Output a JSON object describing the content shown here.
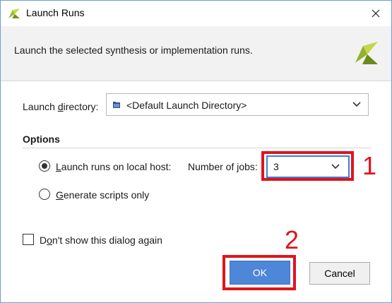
{
  "window": {
    "title": "Launch Runs"
  },
  "header": {
    "description": "Launch the selected synthesis or implementation runs."
  },
  "launch_directory": {
    "label_pre": "Launch ",
    "label_underline": "d",
    "label_post": "irectory:",
    "value": "<Default Launch Directory>"
  },
  "options": {
    "title": "Options",
    "local_host": {
      "underline": "L",
      "rest": "aunch runs on local host:",
      "selected": true
    },
    "jobs_label": "Number of jobs:",
    "jobs_value": "3",
    "scripts_only": {
      "underline": "G",
      "rest": "enerate scripts only",
      "selected": false
    }
  },
  "dont_show": {
    "pre": "D",
    "underline": "o",
    "rest": "n't show this dialog again",
    "checked": false
  },
  "buttons": {
    "ok": "OK",
    "cancel": "Cancel"
  },
  "annotations": {
    "one": "1",
    "two": "2",
    "color": "#e0141c"
  },
  "colors": {
    "accent": "#4e86d8",
    "focus_border": "#3e7ed6"
  },
  "icons": [
    "vivado-logo-icon",
    "close-icon",
    "folder-icon",
    "chevron-down-icon"
  ]
}
